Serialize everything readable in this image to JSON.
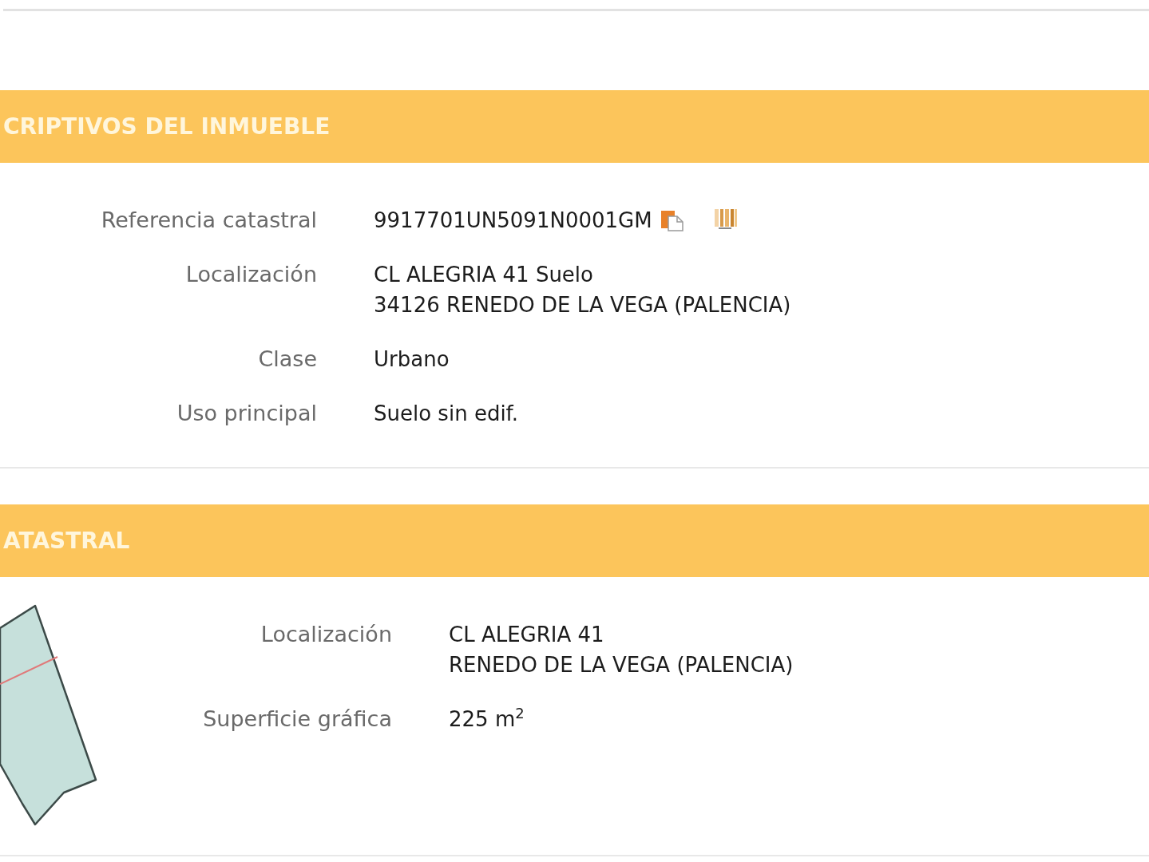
{
  "sections": [
    {
      "kind": "fields",
      "title": "CRIPTIVOS DEL INMUEBLE",
      "fields": [
        {
          "kind": "reference",
          "label": "Referencia catastral",
          "lines": [
            "9917701UN5091N0001GM"
          ]
        },
        {
          "kind": "text",
          "label": "Localización",
          "lines": [
            "CL ALEGRIA 41 Suelo",
            "34126 RENEDO DE LA VEGA (PALENCIA)"
          ]
        },
        {
          "kind": "text",
          "label": "Clase",
          "lines": [
            "Urbano"
          ]
        },
        {
          "kind": "text",
          "label": "Uso principal",
          "lines": [
            "Suelo sin edif."
          ]
        }
      ]
    },
    {
      "kind": "parcel",
      "title": "ATASTRAL",
      "fields": [
        {
          "kind": "text",
          "label": "Localización",
          "lines": [
            "CL ALEGRIA 41",
            "RENEDO DE LA VEGA (PALENCIA)"
          ]
        },
        {
          "kind": "text",
          "label": "Superficie gráfica",
          "lines": [
            "225 m$^{2}$"
          ]
        }
      ]
    }
  ]
}
